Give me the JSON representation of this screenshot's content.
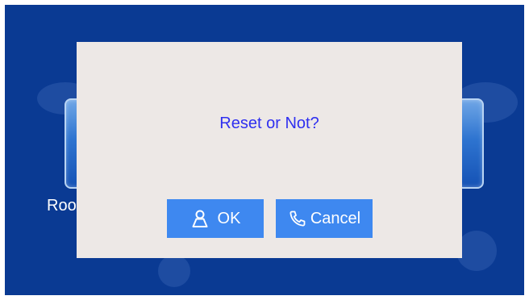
{
  "background": {
    "color": "#0a3a93",
    "tile_label_partial": "Roo"
  },
  "dialog": {
    "message": "Reset or Not?",
    "ok_button": {
      "label": "OK",
      "icon": "person-icon"
    },
    "cancel_button": {
      "label": "Cancel",
      "icon": "phone-icon"
    }
  },
  "colors": {
    "dialog_bg": "#ede8e6",
    "message_text": "#2f2ff0",
    "button_bg": "#3e88f0"
  }
}
